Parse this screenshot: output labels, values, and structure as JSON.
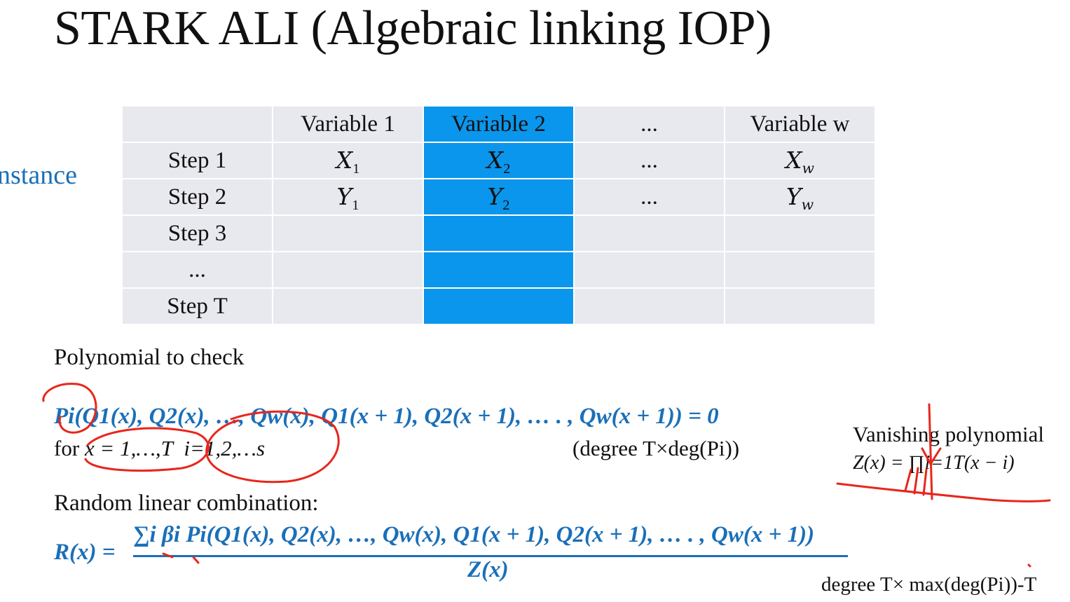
{
  "title": "STARK ALI (Algebraic linking IOP)",
  "instance_label": "nstance",
  "table": {
    "header": [
      "",
      "Variable 1",
      "Variable 2",
      "...",
      "Variable w"
    ],
    "rows": [
      {
        "label": "Step 1",
        "cells": [
          "X",
          "X",
          "...",
          "X"
        ],
        "subs": [
          "1",
          "2",
          "",
          "w"
        ]
      },
      {
        "label": "Step 2",
        "cells": [
          "Y",
          "Y",
          "...",
          "Y"
        ],
        "subs": [
          "1",
          "2",
          "",
          "w"
        ]
      },
      {
        "label": "Step 3",
        "cells": [
          "",
          "",
          "",
          ""
        ],
        "subs": [
          "",
          "",
          "",
          ""
        ]
      },
      {
        "label": "...",
        "cells": [
          "",
          "",
          "",
          ""
        ],
        "subs": [
          "",
          "",
          "",
          ""
        ]
      },
      {
        "label": "Step T",
        "cells": [
          "",
          "",
          "",
          ""
        ],
        "subs": [
          "",
          "",
          "",
          ""
        ]
      }
    ],
    "highlight_color": "#0a96ec"
  },
  "polynomial": {
    "heading": "Polynomial to check",
    "equation": "Pi(Q1(x), Q2(x), …, Qw(x), Q1(x + 1), Q2(x + 1), … . , Qw(x + 1)) = 0",
    "for_prefix": "for ",
    "for_range": "x = 1,…,T",
    "for_index": "i=1,2,…s",
    "degree": "(degree T×deg(Pi))"
  },
  "vanishing": {
    "title": "Vanishing polynomial",
    "formula": "Z(x) = ∏i=1T(x − i)"
  },
  "combination": {
    "heading": "Random linear combination:",
    "lhs": "R(x) =",
    "numerator": "∑i βi Pi(Q1(x), Q2(x), …, Qw(x), Q1(x + 1), Q2(x + 1), … . , Qw(x + 1))",
    "denominator": "Z(x)",
    "degree": "degree T× max(deg(Pi))-T"
  },
  "colors": {
    "accent": "#1a6fb8",
    "annotation": "#e8261c",
    "cell": "#e8e8ef"
  }
}
